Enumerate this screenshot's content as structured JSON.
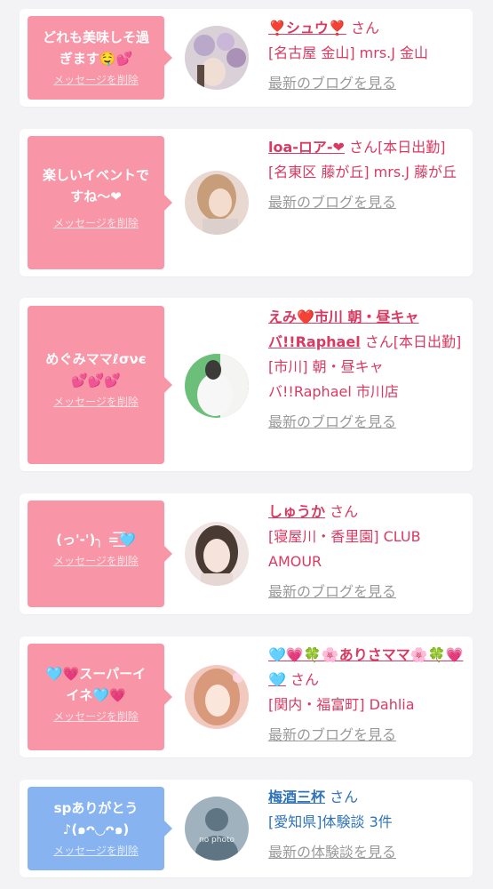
{
  "cards": [
    {
      "message": "どれも美味しそ過\nぎます🤤💕",
      "delete_label": "メッセージを削除",
      "name": "❣️シュウ❣️",
      "suffix": "さん",
      "shop": "[名古屋 金山] mrs.J 金山",
      "blog_link": "最新のブログを見る"
    },
    {
      "message": "楽しいイベントで\nすね〜❤",
      "delete_label": "メッセージを削除",
      "name": "loa-ロア-❤",
      "suffix": "さん[本日出勤]",
      "shop": "[名東区 藤が丘] mrs.J 藤が丘",
      "blog_link": "最新のブログを見る"
    },
    {
      "message": "めぐみママℓσνє\n💕💕💕",
      "delete_label": "メッセージを削除",
      "name": "えみ❤️市川 朝・昼キャバ!!Raphael",
      "suffix": "さん[本日出勤]",
      "shop": "[市川] 朝・昼キャバ!!Raphael 市川店",
      "blog_link": "最新のブログを見る"
    },
    {
      "message": "(っ'-')╮ =͟͟͞͞🩵",
      "delete_label": "メッセージを削除",
      "name": "しゅうか",
      "suffix": "さん",
      "shop": "[寝屋川・香里園] CLUB AMOUR",
      "blog_link": "最新のブログを見る"
    },
    {
      "message": "🩵💗スーパーイ\nイネ🩵💗",
      "delete_label": "メッセージを削除",
      "name": "🩵💗🍀🌸ありさママ🌸🍀💗🩵",
      "suffix": "さん",
      "shop": "[関内・福富町] Dahlia",
      "blog_link": "最新のブログを見る"
    },
    {
      "message": "spありがとう\n♪(๑ᴖ◡ᴖ๑)",
      "delete_label": "メッセージを削除",
      "name": "梅酒三杯",
      "suffix": "さん",
      "shop": "[愛知県]体験談 3件",
      "blog_link": "最新の体験談を見る",
      "avatar_text": "no photo"
    }
  ],
  "colors": {
    "pink_bubble": "#f895a7",
    "blue_bubble": "#87b3f1",
    "pink_text": "#d93a62",
    "blue_text": "#2f73b9"
  }
}
